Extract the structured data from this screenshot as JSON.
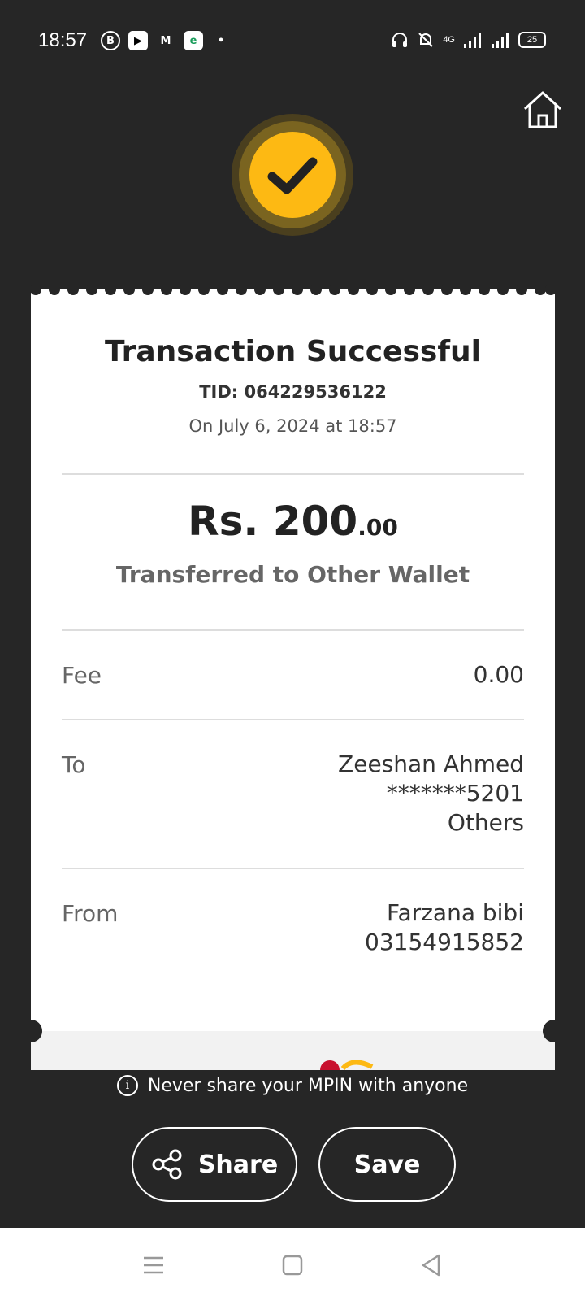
{
  "status_bar": {
    "time": "18:57",
    "battery": "25",
    "network": "4G"
  },
  "receipt": {
    "title": "Transaction Successful",
    "tid": "TID: 064229536122",
    "date": "On July 6, 2024 at 18:57",
    "amount_main": "Rs. 200",
    "amount_decimal": ".00",
    "transfer_type": "Transferred to Other Wallet",
    "fee_label": "Fee",
    "fee_value": "0.00",
    "to_label": "To",
    "to_name": "Zeeshan Ahmed",
    "to_account": "*******5201",
    "to_type": "Others",
    "from_label": "From",
    "from_name": "Farzana bibi",
    "from_number": "03154915852"
  },
  "warning": {
    "text": "Never share your MPIN with anyone"
  },
  "actions": {
    "share_label": "Share",
    "save_label": "Save"
  },
  "colors": {
    "accent": "#FDB913",
    "background": "#262626",
    "card": "#FFFFFF"
  }
}
